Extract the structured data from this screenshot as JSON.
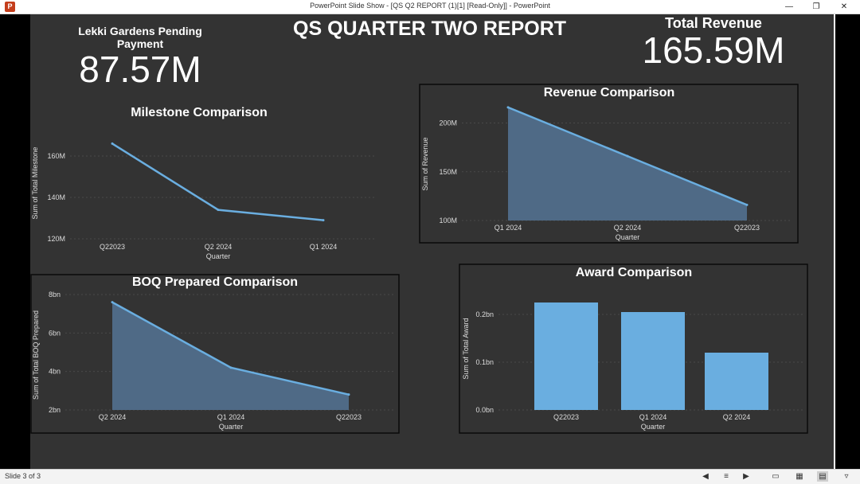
{
  "window": {
    "title": "PowerPoint Slide Show - [QS Q2 REPORT (1)[1] [Read-Only]] - PowerPoint",
    "app_icon": "P",
    "min_glyph": "—",
    "restore_glyph": "❐",
    "close_glyph": "✕"
  },
  "status": {
    "slide_info": "Slide 3 of 3"
  },
  "slide": {
    "title": "QS QUARTER TWO REPORT",
    "kpi_left": {
      "label_line1": "Lekki Gardens Pending",
      "label_line2": "Payment",
      "value": "87.57M"
    },
    "kpi_right": {
      "label": "Total Revenue",
      "value": "165.59M"
    }
  },
  "chart_data": [
    {
      "id": "milestone",
      "type": "line",
      "title": "Milestone Comparison",
      "xlabel": "Quarter",
      "ylabel": "Sum of Total Milestone",
      "categories": [
        "Q22023",
        "Q2 2024",
        "Q1 2024"
      ],
      "values": [
        166,
        134,
        129
      ],
      "unit": "M",
      "ylim": [
        120,
        170
      ],
      "yticks": [
        120,
        140,
        160
      ],
      "ytick_labels": [
        "120M",
        "140M",
        "160M"
      ],
      "grid": true,
      "color": "#6aaee0"
    },
    {
      "id": "revenue",
      "type": "area",
      "title": "Revenue Comparison",
      "xlabel": "Quarter",
      "ylabel": "Sum of Revenue",
      "categories": [
        "Q1 2024",
        "Q2 2024",
        "Q22023"
      ],
      "values": [
        216,
        166,
        116
      ],
      "unit": "M",
      "ylim": [
        100,
        220
      ],
      "yticks": [
        100,
        150,
        200
      ],
      "ytick_labels": [
        "100M",
        "150M",
        "200M"
      ],
      "grid": true,
      "color": "#6aaee0"
    },
    {
      "id": "boq",
      "type": "area",
      "title": "BOQ Prepared Comparison",
      "xlabel": "Quarter",
      "ylabel": "Sum of Total BOQ Prepared",
      "categories": [
        "Q2 2024",
        "Q1 2024",
        "Q22023"
      ],
      "values": [
        7.6,
        4.2,
        2.8
      ],
      "unit": "bn",
      "ylim": [
        2,
        8
      ],
      "yticks": [
        2,
        4,
        6,
        8
      ],
      "ytick_labels": [
        "2bn",
        "4bn",
        "6bn",
        "8bn"
      ],
      "grid": true,
      "color": "#6aaee0"
    },
    {
      "id": "award",
      "type": "bar",
      "title": "Award Comparison",
      "xlabel": "Quarter",
      "ylabel": "Sum of Total Award",
      "categories": [
        "Q22023",
        "Q1 2024",
        "Q2 2024"
      ],
      "values": [
        0.225,
        0.205,
        0.12
      ],
      "unit": "bn",
      "ylim": [
        0,
        0.25
      ],
      "yticks": [
        0,
        0.1,
        0.2
      ],
      "ytick_labels": [
        "0.0bn",
        "0.1bn",
        "0.2bn"
      ],
      "grid": true,
      "color": "#6aaee0"
    }
  ]
}
